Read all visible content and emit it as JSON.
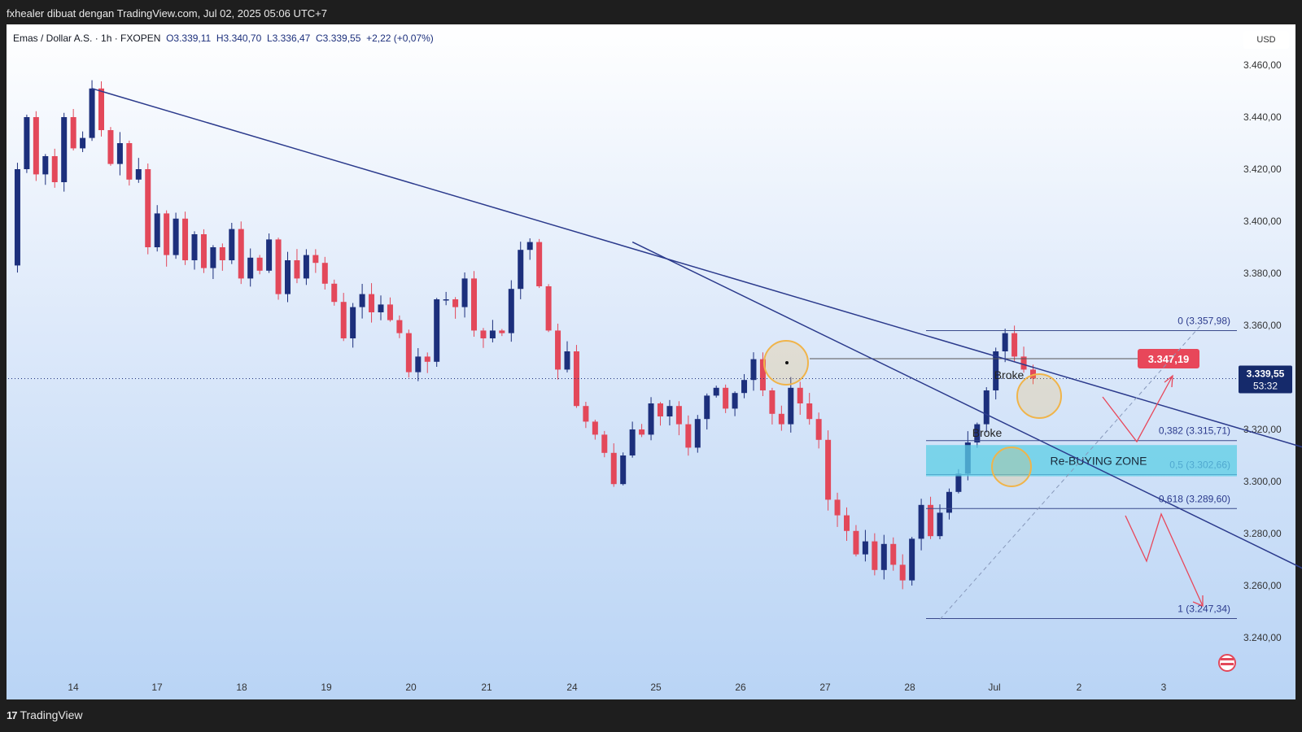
{
  "header": {
    "title": "fxhealer dibuat dengan TradingView.com, Jul 02, 2025 05:06 UTC+7"
  },
  "footer": {
    "brand": "TradingView"
  },
  "legend": {
    "symbol": "Emas / Dollar A.S. · 1h · FXOPEN",
    "open": "O3.339,11",
    "high": "H3.340,70",
    "low": "L3.336,47",
    "close": "C3.339,55",
    "change": "+2,22 (+0,07%)"
  },
  "currency": "USD",
  "colors": {
    "bull": "#1c2f7c",
    "bear": "#e3485a",
    "trend": "#2b3a8c",
    "zone": "#5ccde6",
    "highlight": "#f0b44a",
    "price_tag": "#e8475a",
    "current_tag": "#152a6b"
  },
  "chart_data": {
    "type": "candlestick",
    "ylim": [
      3230,
      3470
    ],
    "yticks": [
      "3.460,00",
      "3.440,00",
      "3.420,00",
      "3.400,00",
      "3.380,00",
      "3.360,00",
      "3.340,00",
      "3.320,00",
      "3.300,00",
      "3.280,00",
      "3.260,00",
      "3.240,00"
    ],
    "xticks": [
      "14",
      "17",
      "18",
      "19",
      "20",
      "21",
      "24",
      "25",
      "26",
      "27",
      "28",
      "Jul",
      "2",
      "3"
    ],
    "price_path": [
      [
        0,
        3383
      ],
      [
        1,
        3420
      ],
      [
        2,
        3440
      ],
      [
        3,
        3418
      ],
      [
        4,
        3425
      ],
      [
        5,
        3415
      ],
      [
        6,
        3440
      ],
      [
        7,
        3428
      ],
      [
        8,
        3432
      ],
      [
        9,
        3451
      ],
      [
        10,
        3435
      ],
      [
        11,
        3422
      ],
      [
        12,
        3430
      ],
      [
        13,
        3416
      ],
      [
        14,
        3420
      ],
      [
        15,
        3390
      ],
      [
        16,
        3403
      ],
      [
        17,
        3387
      ],
      [
        18,
        3401
      ],
      [
        19,
        3385
      ],
      [
        20,
        3395
      ],
      [
        21,
        3382
      ],
      [
        22,
        3390
      ],
      [
        23,
        3385
      ],
      [
        24,
        3397
      ],
      [
        25,
        3378
      ],
      [
        26,
        3386
      ],
      [
        27,
        3381
      ],
      [
        28,
        3393
      ],
      [
        29,
        3372
      ],
      [
        30,
        3385
      ],
      [
        31,
        3378
      ],
      [
        32,
        3387
      ],
      [
        33,
        3384
      ],
      [
        34,
        3376
      ],
      [
        35,
        3369
      ],
      [
        36,
        3355
      ],
      [
        37,
        3367
      ],
      [
        38,
        3372
      ],
      [
        39,
        3365
      ],
      [
        40,
        3368
      ],
      [
        41,
        3362
      ],
      [
        42,
        3357
      ],
      [
        43,
        3342
      ],
      [
        44,
        3348
      ],
      [
        45,
        3346
      ],
      [
        46,
        3370
      ],
      [
        47,
        3370
      ],
      [
        48,
        3367
      ],
      [
        49,
        3378
      ],
      [
        50,
        3358
      ],
      [
        51,
        3355
      ],
      [
        52,
        3358
      ],
      [
        53,
        3357
      ],
      [
        54,
        3374
      ],
      [
        55,
        3389
      ],
      [
        56,
        3392
      ],
      [
        57,
        3375
      ],
      [
        58,
        3358
      ],
      [
        59,
        3343
      ],
      [
        60,
        3350
      ],
      [
        61,
        3329
      ],
      [
        62,
        3323
      ],
      [
        63,
        3318
      ],
      [
        64,
        3311
      ],
      [
        65,
        3299
      ],
      [
        66,
        3310
      ],
      [
        67,
        3320
      ],
      [
        68,
        3318
      ],
      [
        69,
        3330
      ],
      [
        70,
        3325
      ],
      [
        71,
        3329
      ],
      [
        72,
        3322
      ],
      [
        73,
        3313
      ],
      [
        74,
        3324
      ],
      [
        75,
        3333
      ],
      [
        76,
        3336
      ],
      [
        77,
        3328
      ],
      [
        78,
        3334
      ],
      [
        79,
        3339
      ],
      [
        80,
        3347
      ],
      [
        81,
        3335
      ],
      [
        82,
        3326
      ],
      [
        83,
        3322
      ],
      [
        84,
        3336
      ],
      [
        85,
        3330
      ],
      [
        86,
        3324
      ],
      [
        87,
        3316
      ],
      [
        88,
        3293
      ],
      [
        89,
        3287
      ],
      [
        90,
        3281
      ],
      [
        91,
        3272
      ],
      [
        92,
        3277
      ],
      [
        93,
        3266
      ],
      [
        94,
        3276
      ],
      [
        95,
        3268
      ],
      [
        96,
        3262
      ],
      [
        97,
        3278
      ],
      [
        98,
        3291
      ],
      [
        99,
        3279
      ],
      [
        100,
        3288
      ],
      [
        101,
        3296
      ],
      [
        102,
        3303
      ],
      [
        103,
        3315
      ],
      [
        104,
        3322
      ],
      [
        105,
        3335
      ],
      [
        106,
        3350
      ],
      [
        107,
        3357
      ],
      [
        108,
        3348
      ],
      [
        109,
        3343
      ],
      [
        110,
        3339.55
      ]
    ],
    "trendlines": [
      {
        "from": [
          9,
          3451
        ],
        "to": [
          141,
          3311
        ]
      },
      {
        "from": [
          67,
          3392
        ],
        "to": [
          141,
          3263
        ]
      }
    ],
    "dashed_channel": {
      "from": [
        100,
        3247
      ],
      "to": [
        128,
        3360
      ]
    },
    "fibonacci": [
      {
        "label": "0 (3.357,98)",
        "price": 3357.98
      },
      {
        "label": "0,382 (3.315,71)",
        "price": 3315.71
      },
      {
        "label": "0,5 (3.302,66)",
        "price": 3302.66
      },
      {
        "label": "0,618 (3.289,60)",
        "price": 3289.6
      },
      {
        "label": "1 (3.247,34)",
        "price": 3247.34
      }
    ],
    "resistance_line": {
      "price": 3347.19,
      "label": "3.347,19"
    },
    "zone": {
      "label": "Re-BUYING ZONE",
      "top": 3314,
      "bottom": 3302
    },
    "annotations": [
      "Broke",
      "Broke"
    ],
    "current_price": {
      "label": "3.339,55",
      "countdown": "53:32",
      "price": 3339.55
    }
  }
}
